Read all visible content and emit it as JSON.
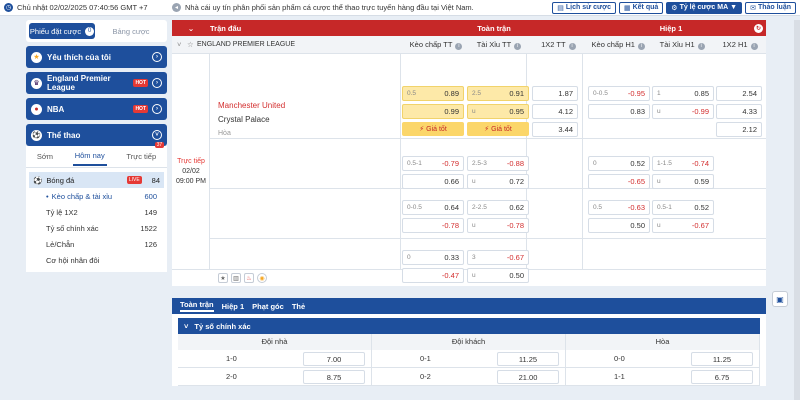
{
  "topbar": {
    "datetime": "Chủ nhật 02/02/2025 07:40:56 GMT +7",
    "ticker": "Nhà cái uy tín phân phối sản phẩm cá cược thể thao trực tuyến hàng đầu tại Việt Nam.",
    "buttons": [
      {
        "label": "Lịch sử cược",
        "icon": "history-icon"
      },
      {
        "label": "Kết quả",
        "icon": "result-icon"
      },
      {
        "label": "Tỷ lệ cược MA",
        "icon": "odds-format-icon",
        "caret": "▼"
      },
      {
        "label": "Thảo luận",
        "icon": "chat-icon"
      }
    ]
  },
  "sidebar": {
    "segment": {
      "active": "Phiếu đặt cược",
      "inactive": "Bảng cược",
      "count": "0"
    },
    "nav": [
      {
        "label": "Yêu thích của tôi",
        "icon": "star-icon",
        "hot": ""
      },
      {
        "label": "England Premier League",
        "icon": "league-icon",
        "hot": "HOT"
      },
      {
        "label": "NBA",
        "icon": "nba-icon",
        "hot": "HOT"
      },
      {
        "label": "Thể thao",
        "icon": "sports-icon",
        "hot": ""
      }
    ],
    "sport_tabs": [
      {
        "label": "Sớm"
      },
      {
        "label": "Hôm nay"
      },
      {
        "label": "Trực tiếp",
        "badge": "37"
      }
    ],
    "sport": {
      "name": "Bóng đá",
      "live": "LIVE",
      "count": "84"
    },
    "sub": [
      {
        "label": "Kèo chấp & tài xỉu",
        "count": "600"
      },
      {
        "label": "Tỷ lệ 1X2",
        "count": "149"
      },
      {
        "label": "Tỷ số chính xác",
        "count": "1522"
      },
      {
        "label": "Lẻ/Chẵn",
        "count": "126"
      },
      {
        "label": "Cơ hội nhân đôi",
        "count": ""
      }
    ]
  },
  "markets": {
    "head1": {
      "match": "Trận đấu",
      "full": "Toàn trận",
      "half": "Hiệp 1"
    },
    "league": "ENGLAND PREMIER LEAGUE",
    "cols": [
      "Kèo chấp TT",
      "Tài Xỉu TT",
      "1X2 TT",
      "Kèo chấp H1",
      "Tài Xỉu H1",
      "1X2 H1"
    ],
    "match": {
      "home": "Manchester United",
      "away": "Crystal Palace",
      "draw": "Hòa",
      "status": "Trực tiếp",
      "date": "02/02",
      "time": "09:00 PM"
    },
    "good_price": "Giá tốt",
    "rows": [
      {
        "hdp": [
          [
            "0.5",
            "0.89"
          ],
          [
            "",
            "0.99"
          ]
        ],
        "ou": [
          [
            "2.5",
            "0.91"
          ],
          [
            "u",
            "0.95"
          ]
        ],
        "x12": [
          "1.87",
          "4.12",
          "3.44"
        ],
        "hdp1": [
          [
            "0-0.5",
            "-0.95"
          ],
          [
            "",
            "0.83"
          ]
        ],
        "ou1": [
          [
            "1",
            "0.85"
          ],
          [
            "u",
            "-0.99"
          ]
        ],
        "x121": [
          "2.54",
          "4.33",
          "2.12"
        ]
      },
      {
        "hdp": [
          [
            "0.5-1",
            "-0.79"
          ],
          [
            "",
            "0.66"
          ]
        ],
        "ou": [
          [
            "2.5-3",
            "-0.88"
          ],
          [
            "u",
            "0.72"
          ]
        ],
        "hdp1": [
          [
            "0",
            "0.52"
          ],
          [
            "",
            "-0.65"
          ]
        ],
        "ou1": [
          [
            "1-1.5",
            "-0.74"
          ],
          [
            "u",
            "0.59"
          ]
        ]
      },
      {
        "hdp": [
          [
            "0-0.5",
            "0.64"
          ],
          [
            "",
            "-0.78"
          ]
        ],
        "ou": [
          [
            "2-2.5",
            "0.62"
          ],
          [
            "u",
            "-0.78"
          ]
        ],
        "hdp1": [
          [
            "0.5",
            "-0.63"
          ],
          [
            "",
            "0.50"
          ]
        ],
        "ou1": [
          [
            "0.5-1",
            "0.52"
          ],
          [
            "u",
            "-0.67"
          ]
        ]
      },
      {
        "hdp": [
          [
            "0",
            "0.33"
          ],
          [
            "",
            "-0.47"
          ]
        ],
        "ou": [
          [
            "3",
            "-0.67"
          ],
          [
            "u",
            "0.50"
          ]
        ]
      }
    ]
  },
  "detail": {
    "tabs": [
      "Toàn trận",
      "Hiệp 1",
      "Phạt góc",
      "Thẻ"
    ],
    "section": "Tỷ số chính xác",
    "cols": [
      "Đội nhà",
      "Đội khách",
      "Hòa"
    ],
    "rows": [
      [
        [
          "1-0",
          "7.00"
        ],
        [
          "0-1",
          "11.25"
        ],
        [
          "0-0",
          "11.25"
        ]
      ],
      [
        [
          "2-0",
          "8.75"
        ],
        [
          "0-2",
          "21.00"
        ],
        [
          "1-1",
          "6.75"
        ]
      ]
    ]
  }
}
